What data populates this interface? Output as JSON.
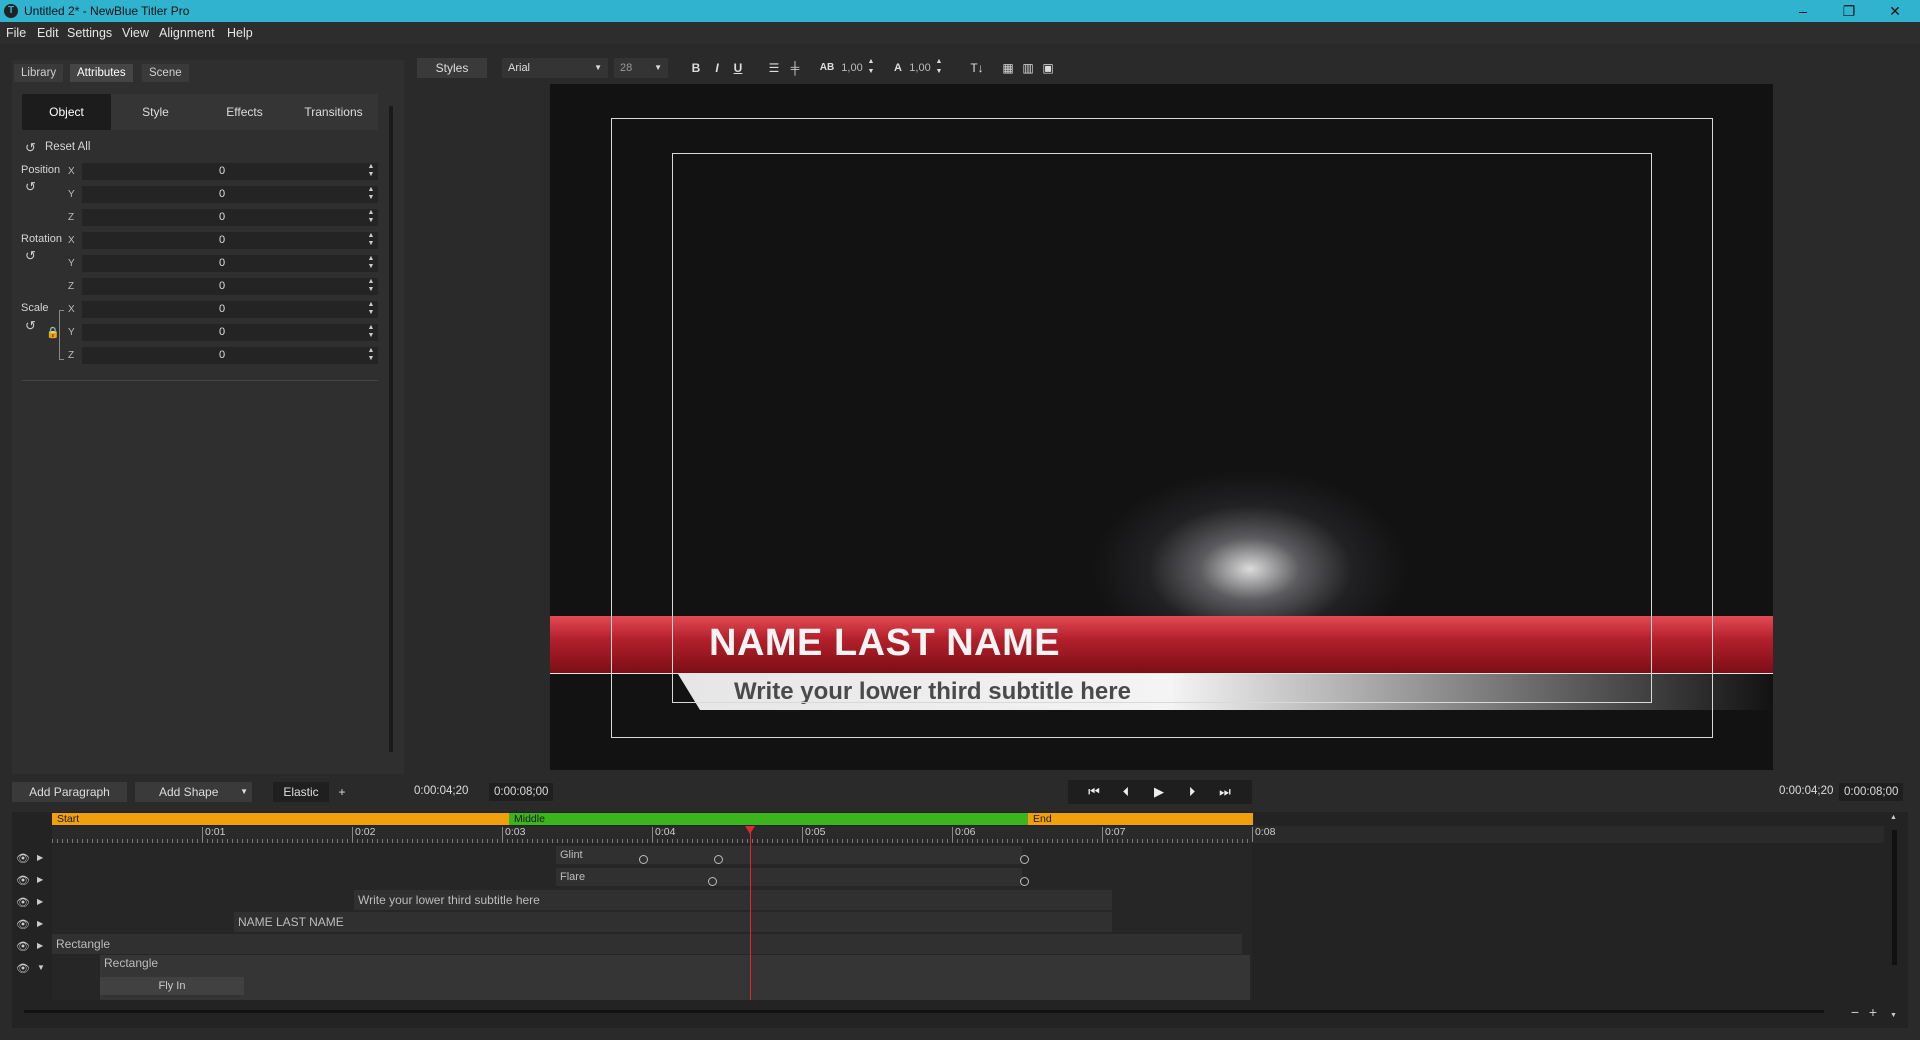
{
  "window": {
    "title": "Untitled 2* - NewBlue Titler Pro",
    "app_icon": "T",
    "controls": [
      "–",
      "❐",
      "✕"
    ]
  },
  "menu": [
    "File",
    "Edit",
    "Settings",
    "View",
    "Alignment",
    "Help"
  ],
  "left_tabs": [
    {
      "label": "Library",
      "active": false
    },
    {
      "label": "Attributes",
      "active": true
    },
    {
      "label": "Scene",
      "active": false
    }
  ],
  "sub_tabs": [
    {
      "label": "Object",
      "active": true
    },
    {
      "label": "Style",
      "active": false
    },
    {
      "label": "Effects",
      "active": false
    },
    {
      "label": "Transitions",
      "active": false
    }
  ],
  "reset_all": "Reset All",
  "properties": [
    {
      "label": "Position",
      "axes": [
        {
          "axis": "X",
          "value": "0"
        },
        {
          "axis": "Y",
          "value": "0"
        },
        {
          "axis": "Z",
          "value": "0"
        }
      ]
    },
    {
      "label": "Rotation",
      "axes": [
        {
          "axis": "X",
          "value": "0"
        },
        {
          "axis": "Y",
          "value": "0"
        },
        {
          "axis": "Z",
          "value": "0"
        }
      ]
    },
    {
      "label": "Scale",
      "axes": [
        {
          "axis": "X",
          "value": "0"
        },
        {
          "axis": "Y",
          "value": "0"
        },
        {
          "axis": "Z",
          "value": "0"
        }
      ]
    }
  ],
  "toolbar": {
    "styles": "Styles",
    "font": "Arial",
    "size": "28",
    "bold": "B",
    "italic": "I",
    "underline": "U",
    "kerning_label": "AB",
    "kerning": "1,00",
    "leading_label": "A",
    "leading": "1,00"
  },
  "canvas": {
    "name_text": "NAME LAST NAME",
    "subtitle_text": "Write your lower third subtitle here"
  },
  "bottom_controls": {
    "add_paragraph": "Add Paragraph",
    "add_shape": "Add Shape",
    "elastic": "Elastic",
    "plus": "+",
    "current_time": "0:00:04;20",
    "duration": "0:00:08;00",
    "current_time_right": "0:00:04;20",
    "duration_right": "0:00:08;00"
  },
  "transport": [
    "⏮",
    "⏴",
    "▶",
    "⏵",
    "⏭"
  ],
  "timeline": {
    "segments": [
      {
        "label": "Start",
        "color": "#f0a00c"
      },
      {
        "label": "Middle",
        "color": "#3cb41e"
      },
      {
        "label": "End",
        "color": "#f0a00c"
      }
    ],
    "ticks": [
      "0:01",
      "0:02",
      "0:03",
      "0:04",
      "0:05",
      "0:06",
      "0:07",
      "0:08"
    ],
    "tracks": [
      {
        "label": "Glint"
      },
      {
        "label": "Flare"
      },
      {
        "label": "Write your lower third subtitle here"
      },
      {
        "label": "NAME LAST NAME"
      },
      {
        "label": "Rectangle"
      },
      {
        "label": "Rectangle",
        "sub": "Fly In"
      }
    ],
    "zoom_minus": "−",
    "zoom_plus": "+"
  },
  "colors": {
    "titlebar": "#2fb3cf",
    "playhead": "#e0262e",
    "lower_third_red": "#b3202b"
  }
}
